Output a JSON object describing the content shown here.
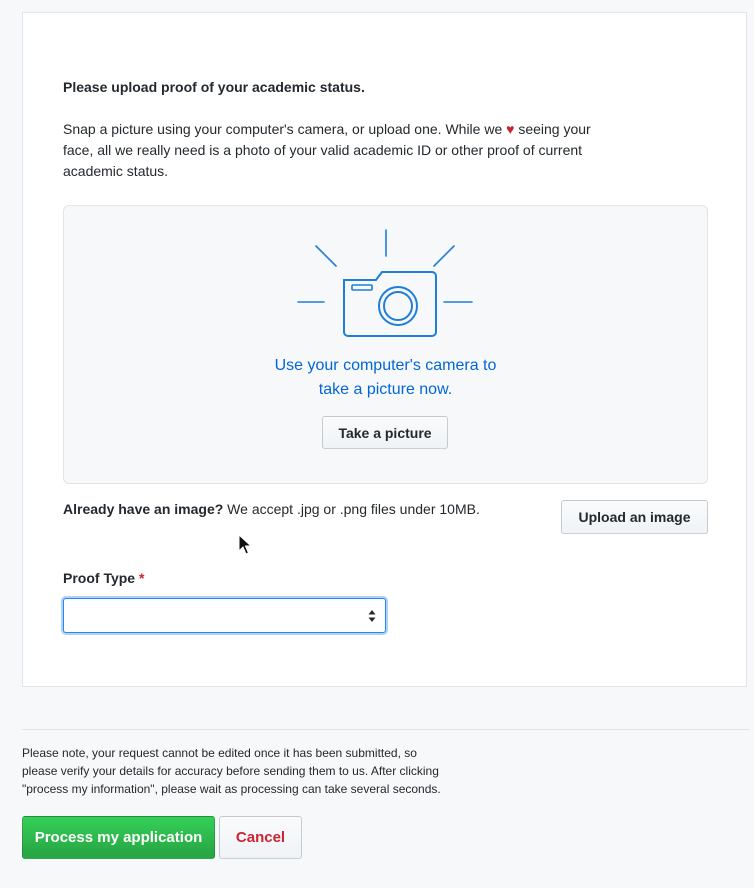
{
  "upload_section": {
    "heading": "Please upload proof of your academic status.",
    "intro_before_heart": "Snap a picture using your computer's camera, or upload one. While we",
    "heart_symbol": "♥",
    "intro_after_heart": " seeing your face, all we really need is a photo of your valid academic ID or other proof of current academic status.",
    "camera_caption_line1": "Use your computer's camera to",
    "camera_caption_line2": "take a picture now.",
    "take_picture_label": "Take a picture",
    "already_bold": "Already have an image?",
    "already_text": " We accept .jpg or .png files under 10MB.",
    "upload_label": "Upload an image"
  },
  "proof_type": {
    "label": "Proof Type",
    "required_marker": "*",
    "selected_value": ""
  },
  "footer": {
    "note": "Please note, your request cannot be edited once it has been submitted, so please verify your details for accuracy before sending them to us. After clicking \"process my information\", please wait as processing can take several seconds.",
    "process_label": "Process my application",
    "cancel_label": "Cancel"
  },
  "icons": {
    "camera": "camera-icon",
    "heart": "heart-icon",
    "select_arrows": "select-arrows-icon",
    "cursor": "mouse-cursor"
  },
  "colors": {
    "accent_blue": "#0366d6",
    "camera_stroke": "#1f7ed8",
    "heart_red": "#cb2431",
    "primary_green": "#28a745"
  }
}
